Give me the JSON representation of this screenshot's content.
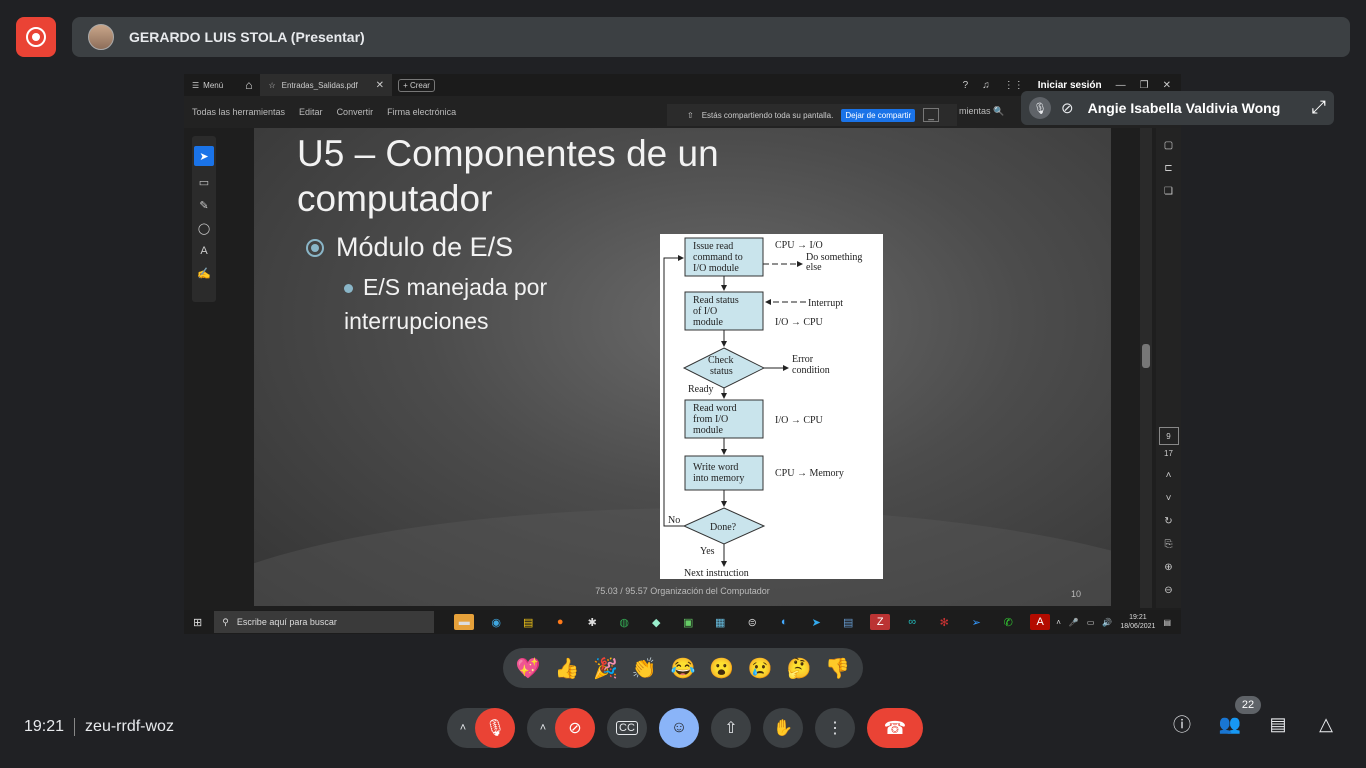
{
  "meeting": {
    "presenter_name": "GERARDO LUIS STOLA (Presentar)",
    "time": "19:21",
    "code": "zeu-rrdf-woz",
    "participant_count": "22",
    "self_name": "Angie Isabella Valdivia Wong"
  },
  "acrobat": {
    "menu_label": "Menú",
    "tab_title": "Entradas_Salidas.pdf",
    "create_label": "Crear",
    "login_label": "Iniciar sesión",
    "tools": [
      "Todas las herramientas",
      "Editar",
      "Convertir",
      "Firma electrónica"
    ],
    "share_notice": "Estás compartiendo toda su pantalla.",
    "stop_share_label": "Dejar de compartir",
    "search_label": "mientas",
    "page_current": "9",
    "page_total": "17"
  },
  "slide": {
    "title": "U5 – Componentes de un computador",
    "bullet1": "Módulo de E/S",
    "bullet2": "E/S manejada por interrupciones",
    "footer": "75.03 / 95.57 Organización del Computador",
    "number": "10"
  },
  "diagram": {
    "box1": [
      "Issue read",
      "command to",
      "I/O module"
    ],
    "box1_right1": "CPU → I/O",
    "box1_right2": [
      "Do something",
      "else"
    ],
    "box2": [
      "Read status",
      "of I/O",
      "module"
    ],
    "box2_right1": "Interrupt",
    "box2_right2": "I/O → CPU",
    "diamond1": [
      "Check",
      "status"
    ],
    "diamond1_right": [
      "Error",
      "condition"
    ],
    "ready": "Ready",
    "box3": [
      "Read word",
      "from I/O",
      "module"
    ],
    "box3_right": "I/O → CPU",
    "box4": [
      "Write word",
      "into memory"
    ],
    "box4_right": "CPU → Memory",
    "diamond2": "Done?",
    "no": "No",
    "yes": "Yes",
    "next": "Next instruction"
  },
  "taskbar": {
    "search_placeholder": "Escribe aquí para buscar",
    "time": "19:21",
    "date": "18/06/2021"
  },
  "reactions": [
    "💖",
    "👍",
    "🎉",
    "👏",
    "😂",
    "😮",
    "😢",
    "🤔",
    "👎"
  ],
  "colors": {
    "record": "#ea4335",
    "hangup": "#ea4335",
    "active_reaction_btn": "#8ab4f8",
    "diagram_box": "#c9e4ec"
  }
}
